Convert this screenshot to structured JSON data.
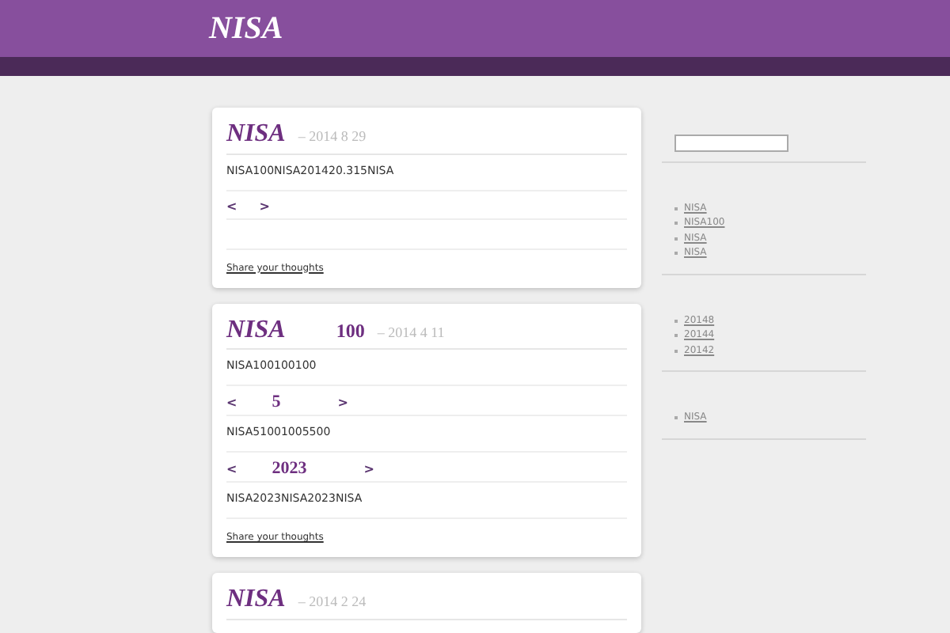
{
  "site": {
    "title": "NISA"
  },
  "posts": [
    {
      "title": "NISA",
      "date": "– 2014  8  29",
      "blocks": [
        {
          "kind": "text",
          "text": "NISA100NISA201420.315NISA"
        },
        {
          "kind": "nav",
          "prev": "<",
          "next": ">"
        },
        {
          "kind": "gap"
        }
      ],
      "share": "Share your thoughts"
    },
    {
      "title": "NISA",
      "subtitle": "100",
      "date": "– 2014  4  11",
      "blocks": [
        {
          "kind": "text",
          "text": "NISA100100100"
        },
        {
          "kind": "nav",
          "prev": "<",
          "middle": "5",
          "next": ">"
        },
        {
          "kind": "text",
          "text": "NISA51001005500"
        },
        {
          "kind": "nav",
          "prev": "<",
          "middle": "2023",
          "next": ">"
        },
        {
          "kind": "text",
          "text": "NISA2023NISA2023NISA"
        }
      ],
      "share": "Share your thoughts"
    },
    {
      "title": "NISA",
      "date": "– 2014  2  24"
    }
  ],
  "sidebar": {
    "widgets": [
      {
        "items": [
          "NISA",
          "NISA100",
          "NISA",
          "NISA"
        ]
      },
      {
        "items": [
          "20148",
          "20144",
          "20142"
        ]
      },
      {
        "items": [
          "NISA"
        ]
      }
    ]
  }
}
